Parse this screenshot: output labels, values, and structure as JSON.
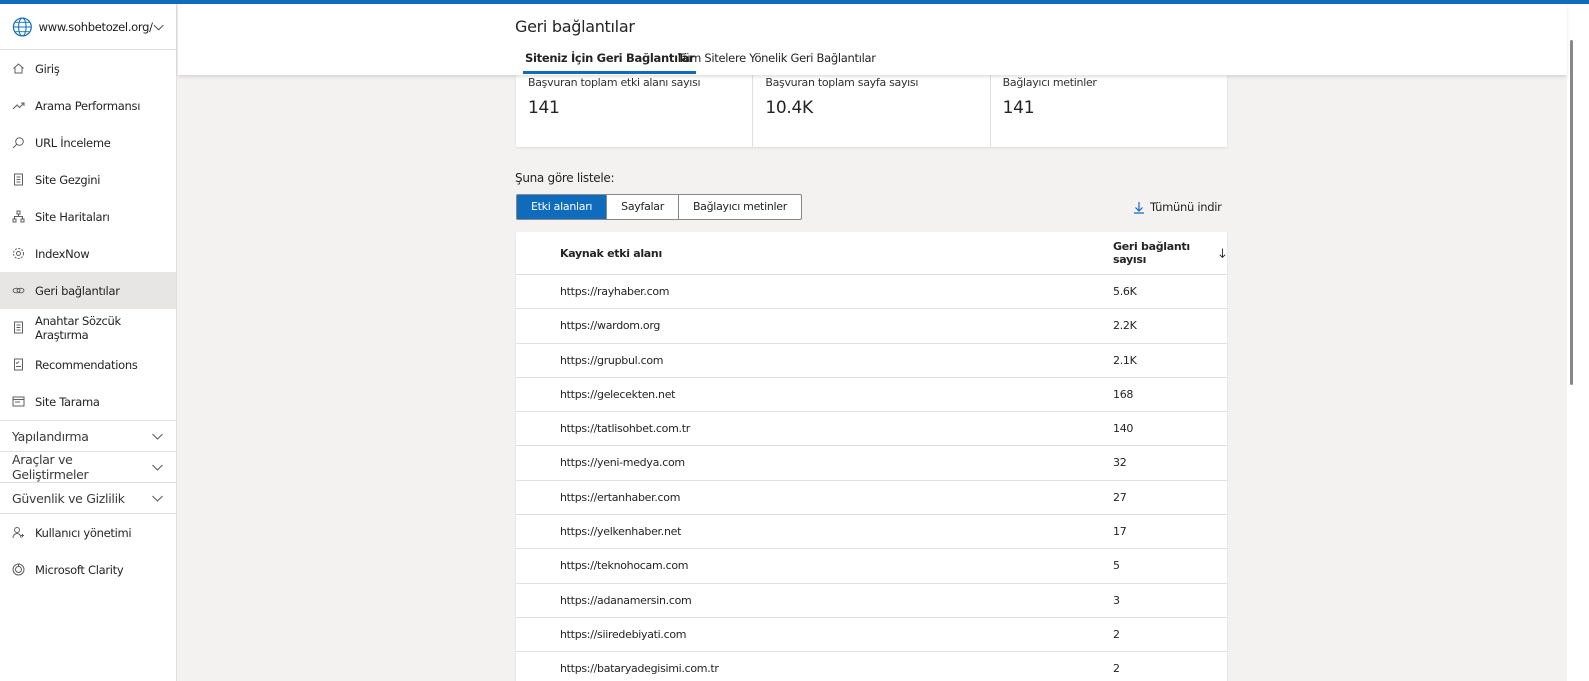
{
  "site": {
    "name": "www.sohbetozel.org/"
  },
  "sidebar": {
    "items": [
      {
        "label": "Giriş",
        "icon": "home-icon"
      },
      {
        "label": "Arama Performansı",
        "icon": "trend-icon"
      },
      {
        "label": "URL İnceleme",
        "icon": "search-icon"
      },
      {
        "label": "Site Gezgini",
        "icon": "document-icon"
      },
      {
        "label": "Site Haritaları",
        "icon": "sitemap-icon"
      },
      {
        "label": "IndexNow",
        "icon": "gear-icon"
      },
      {
        "label": "Geri bağlantılar",
        "icon": "link-icon",
        "active": true
      },
      {
        "label": "Anahtar Sözcük Araştırma",
        "icon": "document-icon"
      },
      {
        "label": "Recommendations",
        "icon": "checklist-icon"
      },
      {
        "label": "Site Tarama",
        "icon": "scan-icon"
      }
    ],
    "groups": [
      {
        "label": "Yapılandırma"
      },
      {
        "label": "Araçlar ve Geliştirmeler"
      },
      {
        "label": "Güvenlik ve Gizlilik"
      }
    ],
    "bottom_items": [
      {
        "label": "Kullanıcı yönetimi",
        "icon": "user-icon"
      },
      {
        "label": "Microsoft Clarity",
        "icon": "clarity-icon"
      }
    ]
  },
  "header": {
    "title": "Geri bağlantılar",
    "tabs": [
      {
        "label": "Siteniz İçin Geri Bağlantılar",
        "active": true
      },
      {
        "label": "Tüm Sitelere Yönelik Geri Bağlantılar",
        "active": false
      }
    ]
  },
  "stats": [
    {
      "label": "Başvuran toplam etki alanı sayısı",
      "value": "141"
    },
    {
      "label": "Başvuran toplam sayfa sayısı",
      "value": "10.4K"
    },
    {
      "label": "Bağlayıcı metinler",
      "value": "141"
    }
  ],
  "list_by": {
    "label": "Şuna göre listele:",
    "options": [
      {
        "label": "Etki alanları",
        "active": true
      },
      {
        "label": "Sayfalar",
        "active": false
      },
      {
        "label": "Bağlayıcı metinler",
        "active": false
      }
    ]
  },
  "download_label": "Tümünü indir",
  "table": {
    "columns": [
      "Kaynak etki alanı",
      "Geri bağlantı sayısı"
    ],
    "rows": [
      [
        "https://rayhaber.com",
        "5.6K"
      ],
      [
        "https://wardom.org",
        "2.2K"
      ],
      [
        "https://grupbul.com",
        "2.1K"
      ],
      [
        "https://gelecekten.net",
        "168"
      ],
      [
        "https://tatlisohbet.com.tr",
        "140"
      ],
      [
        "https://yeni-medya.com",
        "32"
      ],
      [
        "https://ertanhaber.com",
        "27"
      ],
      [
        "https://yelkenhaber.net",
        "17"
      ],
      [
        "https://teknohocam.com",
        "5"
      ],
      [
        "https://adanamersin.com",
        "3"
      ],
      [
        "https://siiredebiyati.com",
        "2"
      ],
      [
        "https://bataryadegisimi.com.tr",
        "2"
      ]
    ]
  },
  "colors": {
    "accent": "#0f6cbd",
    "background": "#f3f2f1"
  }
}
